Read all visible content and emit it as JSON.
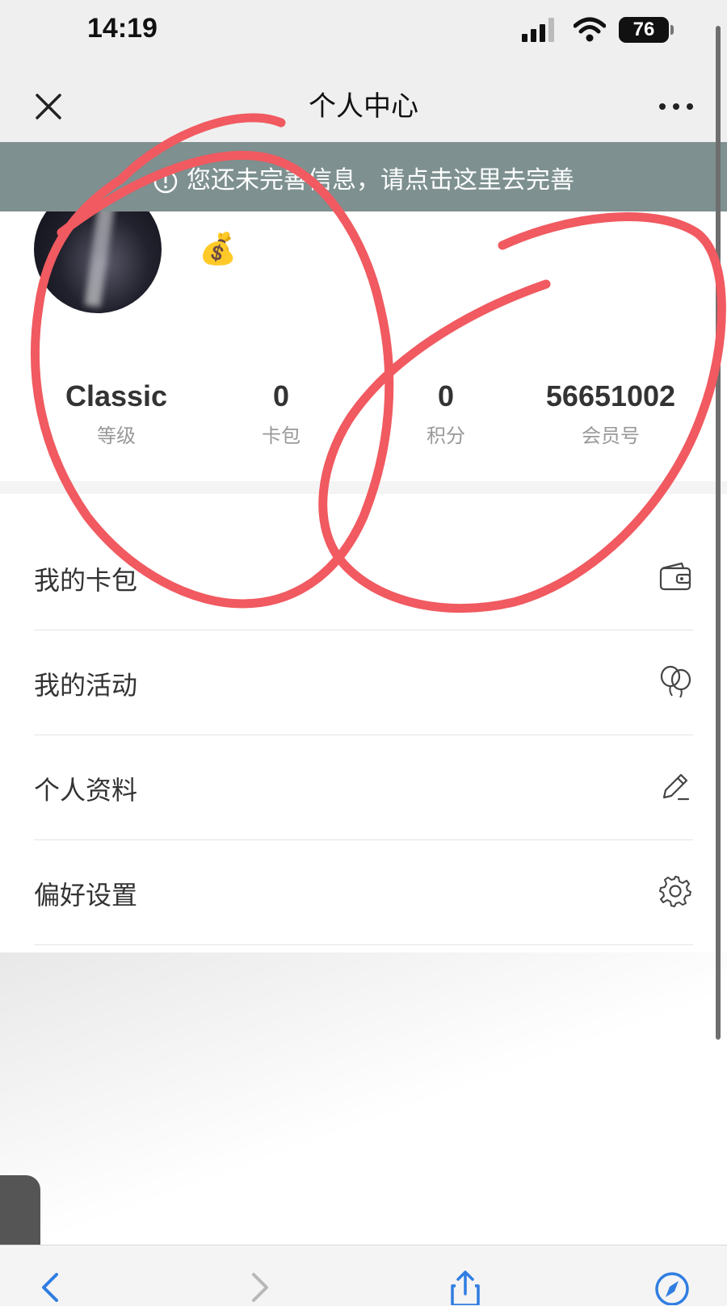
{
  "status_bar": {
    "time": "14:19",
    "battery": "76"
  },
  "nav": {
    "title": "个人中心"
  },
  "notice": {
    "text": "您还未完善信息，请点击这里去完善"
  },
  "profile": {
    "stats": [
      {
        "value": "Classic",
        "label": "等级"
      },
      {
        "value": "0",
        "label": "卡包"
      },
      {
        "value": "0",
        "label": "积分"
      },
      {
        "value": "56651002",
        "label": "会员号"
      }
    ]
  },
  "menu": [
    {
      "label": "我的卡包",
      "icon": "wallet-icon"
    },
    {
      "label": "我的活动",
      "icon": "balloons-icon"
    },
    {
      "label": "个人资料",
      "icon": "edit-icon"
    },
    {
      "label": "偏好设置",
      "icon": "gear-icon"
    }
  ],
  "colors": {
    "banner": "#7e9090",
    "annotation": "#f05a60",
    "toolbar_icon": "#2f7de1"
  }
}
